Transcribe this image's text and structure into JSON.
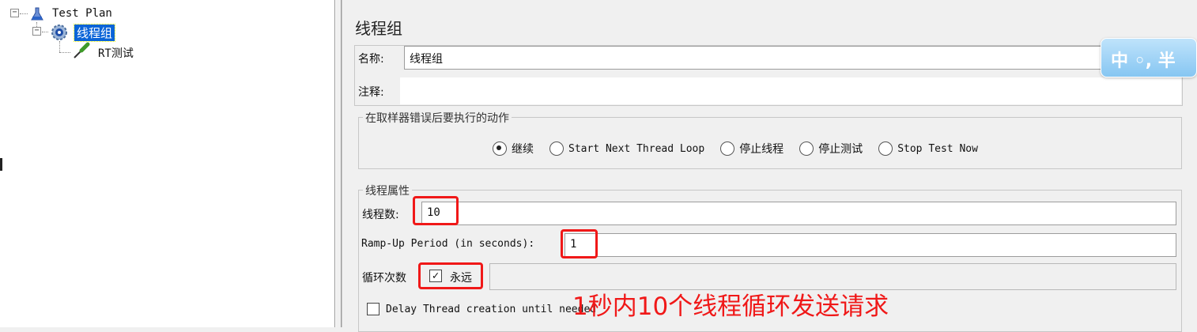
{
  "tree": {
    "root": "Test Plan",
    "thread_group": "线程组",
    "sampler": "RT测试"
  },
  "panel": {
    "title": "线程组",
    "name_label": "名称:",
    "name_value": "线程组",
    "comment_label": "注释:",
    "comment_value": "",
    "error_action": {
      "legend": "在取样器错误后要执行的动作",
      "options": [
        "继续",
        "Start Next Thread Loop",
        "停止线程",
        "停止测试",
        "Stop Test Now"
      ],
      "selected_index": 0
    },
    "thread_props": {
      "legend": "线程属性",
      "threads_label": "线程数:",
      "threads_value": "10",
      "rampup_label": "Ramp-Up Period (in seconds):",
      "rampup_value": "1",
      "loop_label": "循环次数",
      "forever_label": "永远",
      "forever_checked": true,
      "loop_value": "",
      "delay_label": "Delay Thread creation until needed",
      "delay_checked": false
    }
  },
  "annotation": "1秒内10个线程循环发送请求",
  "ime": "中 ◦, 半",
  "colors": {
    "highlight": "#f01818",
    "selection": "#0a64d8"
  }
}
